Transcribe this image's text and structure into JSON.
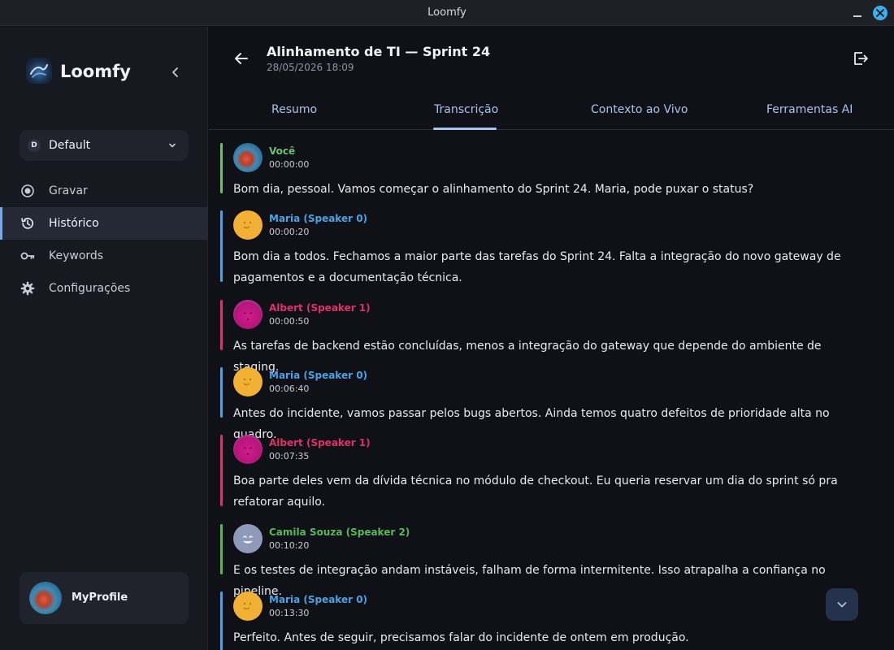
{
  "window": {
    "title": "Loomfy"
  },
  "sidebar": {
    "brand": "Loomfy",
    "profile": {
      "badge": "D",
      "name": "Default"
    },
    "items": [
      {
        "label": "Gravar",
        "icon": "record-icon"
      },
      {
        "label": "Histórico",
        "icon": "history-icon",
        "active": true
      },
      {
        "label": "Keywords",
        "icon": "key-icon"
      },
      {
        "label": "Configurações",
        "icon": "gear-icon"
      }
    ],
    "user": {
      "name": "MyProfile"
    }
  },
  "header": {
    "title": "Alinhamento de TI — Sprint 24",
    "date": "28/05/2026 18:09"
  },
  "tabs": [
    {
      "label": "Resumo"
    },
    {
      "label": "Transcrição",
      "active": true
    },
    {
      "label": "Contexto ao Vivo"
    },
    {
      "label": "Ferramentas AI"
    }
  ],
  "speaker_colors": {
    "voce": "#6cc070",
    "maria": "#4aa3e6",
    "albert": "#e0306a",
    "camila": "#58b85c"
  },
  "transcript": [
    {
      "speaker": "Você",
      "time": "00:00:00",
      "text": "Bom dia, pessoal. Vamos começar o alinhamento do Sprint 24. Maria, pode puxar o status?"
    },
    {
      "speaker": "Maria (Speaker 0)",
      "time": "00:00:20",
      "text": "Bom dia a todos. Fechamos a maior parte das tarefas do Sprint 24. Falta a integração do novo gateway de pagamentos e a documentação técnica."
    },
    {
      "speaker": "Albert (Speaker 1)",
      "time": "00:00:50",
      "text": "As tarefas de backend estão concluídas, menos a integração do gateway que depende do ambiente de staging."
    },
    {
      "speaker": "Maria (Speaker 0)",
      "time": "00:06:40",
      "text": "Antes do incidente, vamos passar pelos bugs abertos. Ainda temos quatro defeitos de prioridade alta no quadro."
    },
    {
      "speaker": "Albert (Speaker 1)",
      "time": "00:07:35",
      "text": "Boa parte deles vem da dívida técnica no módulo de checkout. Eu queria reservar um dia do sprint só pra refatorar aquilo."
    },
    {
      "speaker": "Camila Souza (Speaker 2)",
      "time": "00:10:20",
      "text": "E os testes de integração andam instáveis, falham de forma intermitente. Isso atrapalha a confiança no pipeline."
    },
    {
      "speaker": "Maria (Speaker 0)",
      "time": "00:13:30",
      "text": "Perfeito. Antes de seguir, precisamos falar do incidente de ontem em produção."
    }
  ]
}
